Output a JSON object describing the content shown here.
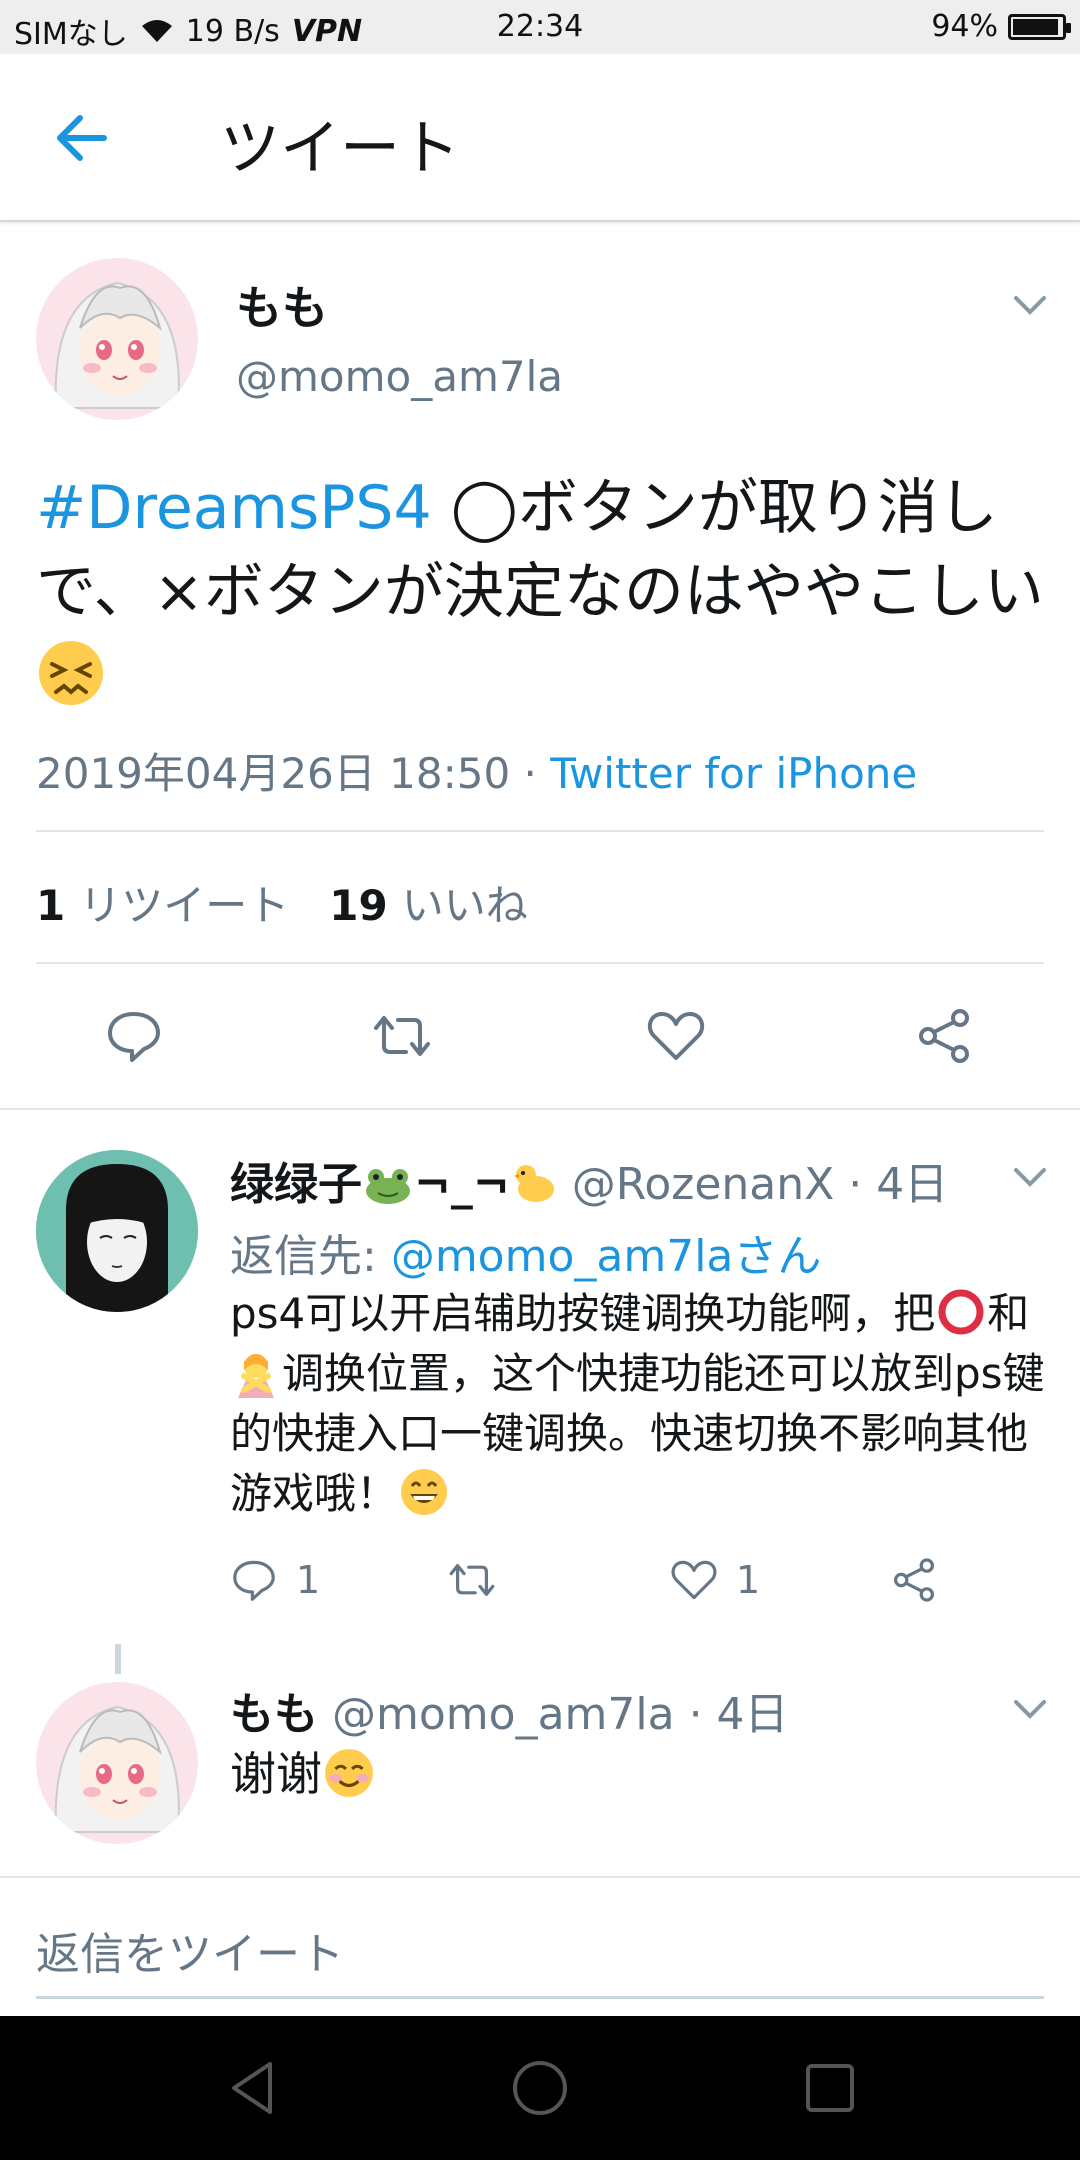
{
  "status_bar": {
    "carrier": "SIMなし",
    "speed": "19 B/s",
    "vpn": "VPN",
    "time": "22:34",
    "battery_pct": "94%",
    "battery_level": 0.94
  },
  "header": {
    "title": "ツイート"
  },
  "main_tweet": {
    "name": "もも",
    "handle": "@momo_am7la",
    "hashtag": "#DreamsPS4",
    "text_rest": " ◯ボタンが取り消しで、×ボタンが決定なのはややこしい",
    "emoji": "persevering-face",
    "date": "2019年04月26日 18:50",
    "separator": " · ",
    "source": "Twitter for iPhone",
    "retweet_count": "1",
    "retweet_label": "リツイート",
    "like_count": "19",
    "like_label": "いいね"
  },
  "reply1": {
    "name": "绿绿子",
    "name_suffix": "¬_¬",
    "handle": "@RozenanX",
    "time": " · 4日",
    "reply_prefix": "返信先: ",
    "reply_to": "@momo_am7laさん",
    "text_part1": "ps4可以开启辅助按键调换功能啊，把",
    "text_part2": "和",
    "text_part3": "调换位置，这个快捷功能还可以放到ps键的快捷入口一键调换。快速切换不影响其他游戏哦！",
    "reply_count": "1",
    "like_count": "1"
  },
  "reply2": {
    "name": "もも",
    "handle": "@momo_am7la",
    "time": " · 4日",
    "text": "谢谢"
  },
  "compose": {
    "placeholder": "返信をツイート"
  },
  "colors": {
    "accent": "#1b95e0",
    "muted": "#657786",
    "text": "#14171a"
  }
}
